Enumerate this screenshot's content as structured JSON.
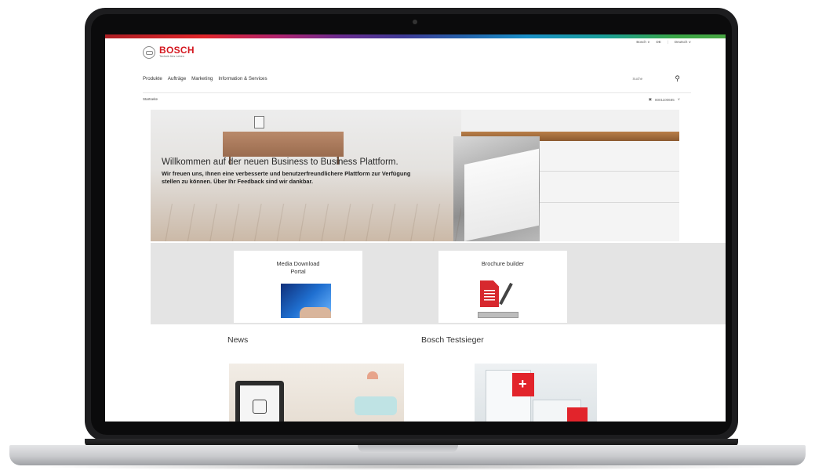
{
  "utility": {
    "country": "Bosch",
    "country_caret": "∨",
    "lang_short": "DE",
    "language": "Deutsch",
    "language_caret": "∨"
  },
  "brand": {
    "name": "BOSCH",
    "claim": "Technik fürs Leben"
  },
  "nav": [
    "Produkte",
    "Aufträge",
    "Marketing",
    "Information & Services"
  ],
  "search": {
    "placeholder": "Suche"
  },
  "breadcrumb": "Startseite",
  "account": {
    "number": "8001100685",
    "caret": "∨"
  },
  "hero": {
    "title": "Willkommen auf der neuen Business to Business Plattform.",
    "body": "Wir freuen uns, Ihnen eine verbesserte und benutzerfreundlichere Plattform zur Verfügung stellen zu können. Über Ihr Feedback sind wir dankbar."
  },
  "tiles": [
    {
      "title_line1": "Media Download",
      "title_line2": "Portal"
    },
    {
      "title_line1": "Brochure builder",
      "title_line2": ""
    }
  ],
  "sections": {
    "news": "News",
    "testsieger": "Bosch Testsieger"
  },
  "icons": {
    "search": "search-icon",
    "account": "store-icon",
    "logo": "bosch-armature-icon"
  },
  "colors": {
    "brand_red": "#d41820",
    "band": "#e4e4e4"
  }
}
